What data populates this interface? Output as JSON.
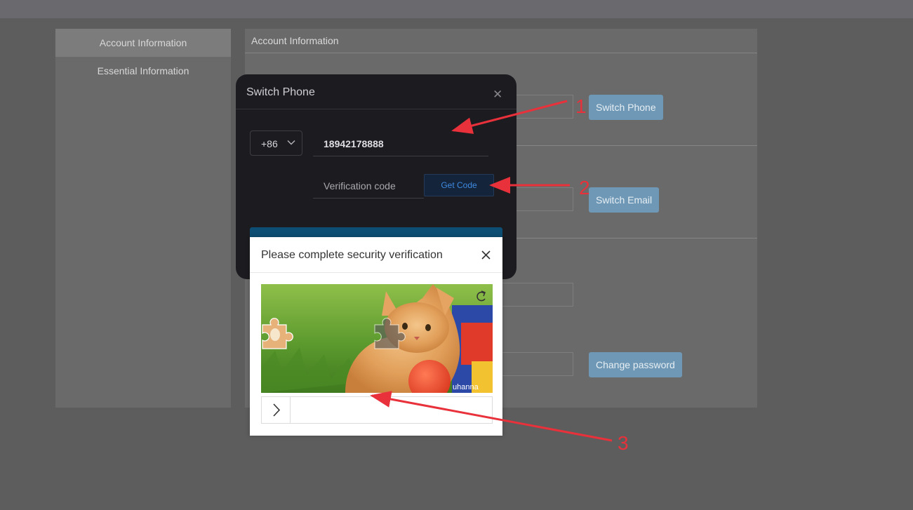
{
  "sidebar": {
    "items": [
      {
        "label": "Account Information",
        "active": true
      },
      {
        "label": "Essential Information",
        "active": false
      }
    ]
  },
  "main": {
    "title": "Account Information",
    "switch_phone_label": "Switch Phone",
    "switch_email_label": "Switch Email",
    "change_password_label": "Change password"
  },
  "switch_phone_dialog": {
    "title": "Switch Phone",
    "country_code": "+86",
    "phone_value": "18942178888",
    "code_placeholder": "Verification code",
    "get_code_label": "Get Code"
  },
  "security_dialog": {
    "title": "Please complete security verification",
    "watermark": "uhanna"
  },
  "annotations": {
    "label_1": "1",
    "label_2": "2",
    "label_3": "3",
    "arrow_color": "#e8313a"
  }
}
